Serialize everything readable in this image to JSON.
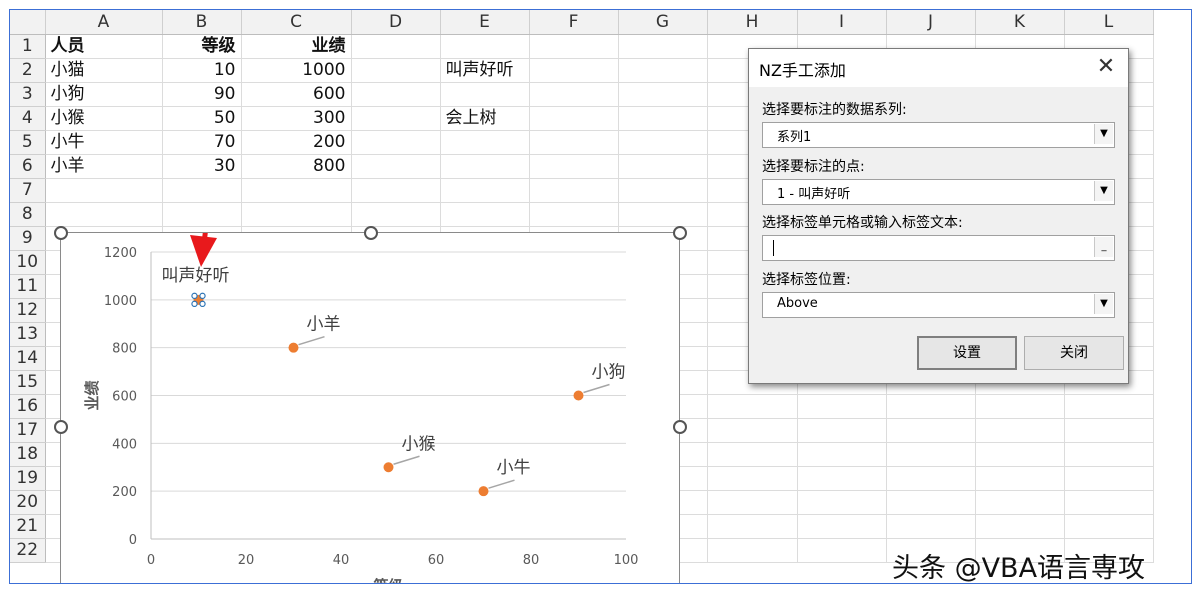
{
  "sheet": {
    "columns": [
      "A",
      "B",
      "C",
      "D",
      "E",
      "F",
      "G",
      "H",
      "I",
      "J",
      "K",
      "L"
    ],
    "rows": [
      "1",
      "2",
      "3",
      "4",
      "5",
      "6",
      "7",
      "8",
      "9",
      "10",
      "11",
      "12",
      "13",
      "14",
      "15",
      "16",
      "17",
      "18",
      "19",
      "20",
      "21",
      "22"
    ],
    "header_cells": {
      "a1": "人员",
      "b1": "等级",
      "c1": "业绩"
    },
    "data_rows": [
      {
        "name": "小猫",
        "grade": "10",
        "score": "1000"
      },
      {
        "name": "小狗",
        "grade": "90",
        "score": "600"
      },
      {
        "name": "小猴",
        "grade": "50",
        "score": "300"
      },
      {
        "name": "小牛",
        "grade": "70",
        "score": "200"
      },
      {
        "name": "小羊",
        "grade": "30",
        "score": "800"
      }
    ],
    "e2": "叫声好听",
    "e4": "会上树"
  },
  "chart_data": {
    "type": "scatter",
    "xlabel": "等级",
    "ylabel": "业绩",
    "xlim": [
      0,
      100
    ],
    "ylim": [
      0,
      1200
    ],
    "x_ticks": [
      "0",
      "20",
      "40",
      "60",
      "80",
      "100"
    ],
    "y_ticks": [
      "0",
      "200",
      "400",
      "600",
      "800",
      "1000",
      "1200"
    ],
    "grid": true,
    "marker_color": "#ed7d31",
    "points": [
      {
        "x": 10,
        "y": 1000,
        "label": "叫声好听",
        "selected": true
      },
      {
        "x": 90,
        "y": 600,
        "label": "小狗"
      },
      {
        "x": 50,
        "y": 300,
        "label": "小猴"
      },
      {
        "x": 70,
        "y": 200,
        "label": "小牛"
      },
      {
        "x": 30,
        "y": 800,
        "label": "小羊"
      }
    ]
  },
  "dialog": {
    "title": "NZ手工添加",
    "close_glyph": "✕",
    "series_label": "选择要标注的数据系列:",
    "series_value": "系列1",
    "point_label": "选择要标注的点:",
    "point_value": "1 - 叫声好听",
    "text_label": "选择标签单元格或输入标签文本:",
    "text_value": "",
    "position_label": "选择标签位置:",
    "position_value": "Above",
    "dropdown_glyph": "▼",
    "ref_glyph": "_",
    "set_button": "设置",
    "close_button": "关闭"
  },
  "colors": {
    "accent_border": "#3c6fd6",
    "arrow": "#e8191c"
  },
  "watermark": "头条 @VBA语言専攻"
}
